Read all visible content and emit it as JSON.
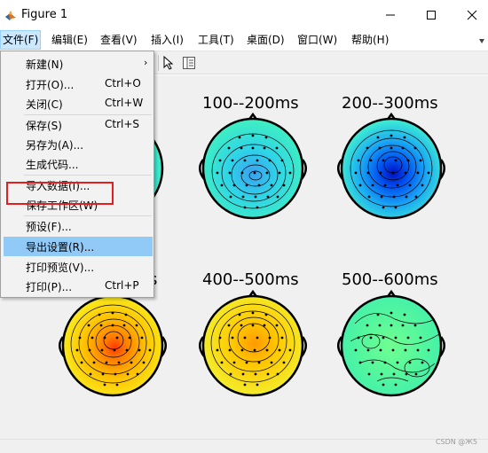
{
  "window": {
    "title": "Figure 1"
  },
  "menubar": {
    "items": [
      "文件(F)",
      "编辑(E)",
      "查看(V)",
      "插入(I)",
      "工具(T)",
      "桌面(D)",
      "窗口(W)",
      "帮助(H)"
    ]
  },
  "file_menu": {
    "items": [
      {
        "label": "新建(N)",
        "accel": "",
        "submenu": true
      },
      {
        "label": "打开(O)...",
        "accel": "Ctrl+O"
      },
      {
        "label": "关闭(C)",
        "accel": "Ctrl+W"
      },
      {
        "label": "保存(S)",
        "accel": "Ctrl+S"
      },
      {
        "label": "另存为(A)...",
        "accel": ""
      },
      {
        "label": "生成代码...",
        "accel": ""
      },
      {
        "label": "导入数据(I)...",
        "accel": ""
      },
      {
        "label": "保存工作区(W)",
        "accel": ""
      },
      {
        "label": "预设(F)...",
        "accel": ""
      },
      {
        "label": "导出设置(R)...",
        "accel": "",
        "highlighted": true
      },
      {
        "label": "打印预览(V)...",
        "accel": ""
      },
      {
        "label": "打印(P)...",
        "accel": "Ctrl+P"
      }
    ],
    "submenu_arrow": "›"
  },
  "toolbar": {
    "icons": [
      "pointer-arrow-icon",
      "property-inspector-icon"
    ]
  },
  "plots": {
    "titles": [
      "100--200ms",
      "200--300ms",
      "s",
      "400--500ms",
      "500--600ms"
    ],
    "colormap": "jet"
  },
  "watermark": "CSDN @Ж5"
}
